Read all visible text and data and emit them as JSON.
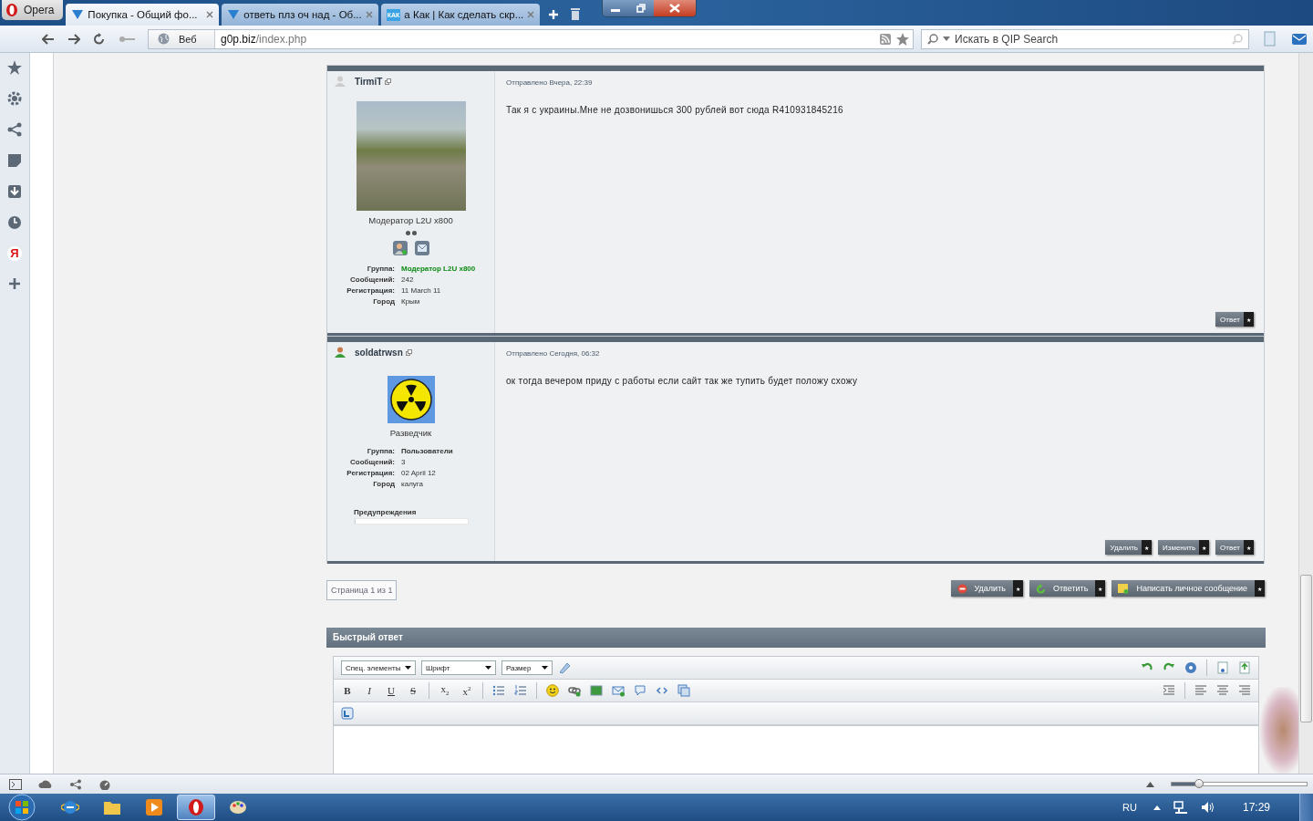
{
  "browser": {
    "menu_label": "Opera",
    "tabs": [
      {
        "title": "Покупка - Общий фо...",
        "selected": true,
        "kind": "forum"
      },
      {
        "title": "ответь плз оч над - Об...",
        "selected": false,
        "kind": "forum"
      },
      {
        "title": "а Как | Как сделать скр...",
        "selected": false,
        "kind": "badge",
        "icon_text": "КАК"
      }
    ],
    "address": {
      "scope": "Веб",
      "host": "g0p.biz",
      "path": "/index.php"
    },
    "search": {
      "placeholder": "Искать в QIP Search"
    },
    "panel_items": [
      {
        "kind": "star"
      },
      {
        "kind": "gear"
      },
      {
        "kind": "share"
      },
      {
        "kind": "note"
      },
      {
        "kind": "download"
      },
      {
        "kind": "clock"
      },
      {
        "kind": "text",
        "text": "Я"
      },
      {
        "kind": "plus"
      }
    ]
  },
  "posts": [
    {
      "author": "TirmiT",
      "online": false,
      "avatar": {
        "kind": "photo"
      },
      "rank": "Модератор L2U x800",
      "rank_dots": true,
      "contact_icons": true,
      "details": [
        {
          "label": "Группа:",
          "value": "Модератор L2U x800",
          "color": "#0a8a12"
        },
        {
          "label": "Сообщений:",
          "value": "242"
        },
        {
          "label": "Регистрация:",
          "value": "11 March 11"
        },
        {
          "label": "Город",
          "value": "Крым"
        }
      ],
      "posted": "Отправлено Вчера, 22:39",
      "text": "Так я с украины.Мне не дозвонишься 300 рублей вот сюда R410931845216",
      "buttons": [
        {
          "label": "Ответ",
          "mark": "★"
        }
      ]
    },
    {
      "author": "soldatrwsn",
      "online": true,
      "avatar": {
        "kind": "radiation"
      },
      "rank": "Разведчик",
      "rank_dots": false,
      "contact_icons": false,
      "details": [
        {
          "label": "Группа:",
          "value": "Пользователи"
        },
        {
          "label": "Сообщений:",
          "value": "3"
        },
        {
          "label": "Регистрация:",
          "value": "02 April 12"
        },
        {
          "label": "Город",
          "value": "калуга"
        }
      ],
      "warnings": {
        "label": "Предупреждения",
        "level": 0
      },
      "posted": "Отправлено Сегодня, 06:32",
      "text": "ок тогда вечером приду с работы если сайт так же тупить будет положу схожу",
      "buttons": [
        {
          "label": "Удалить",
          "mark": "★"
        },
        {
          "label": "Изменить",
          "mark": "★"
        },
        {
          "label": "Ответ",
          "mark": "★"
        }
      ]
    }
  ],
  "pagination": "Страница 1 из 1",
  "actions": [
    {
      "label": "Удалить",
      "kind": "delete",
      "mark": "★"
    },
    {
      "label": "Ответить",
      "kind": "reply",
      "mark": "★"
    },
    {
      "label": "Написать личное сообщение",
      "kind": "message",
      "mark": "★"
    }
  ],
  "quick_reply": {
    "title": "Быстрый ответ",
    "dropdowns": [
      "Спец. элементы",
      "Шрифт",
      "Размер"
    ],
    "format_buttons": [
      {
        "kind": "bold",
        "text": "B"
      },
      {
        "kind": "italic",
        "text": "I"
      },
      {
        "kind": "underline",
        "text": "U"
      },
      {
        "kind": "strike",
        "text": "S"
      },
      {
        "kind": "script",
        "text": "x$_{2}$"
      },
      {
        "kind": "script",
        "text": "x$^{2}$"
      }
    ]
  },
  "zoom": {
    "level": 0.2
  },
  "taskbar": {
    "apps": [
      {
        "kind": "ie",
        "selected": false
      },
      {
        "kind": "folder",
        "selected": false
      },
      {
        "kind": "player",
        "selected": false
      },
      {
        "kind": "opera",
        "selected": true
      },
      {
        "kind": "paint",
        "selected": false
      }
    ],
    "language": "RU",
    "time": "17:29"
  }
}
